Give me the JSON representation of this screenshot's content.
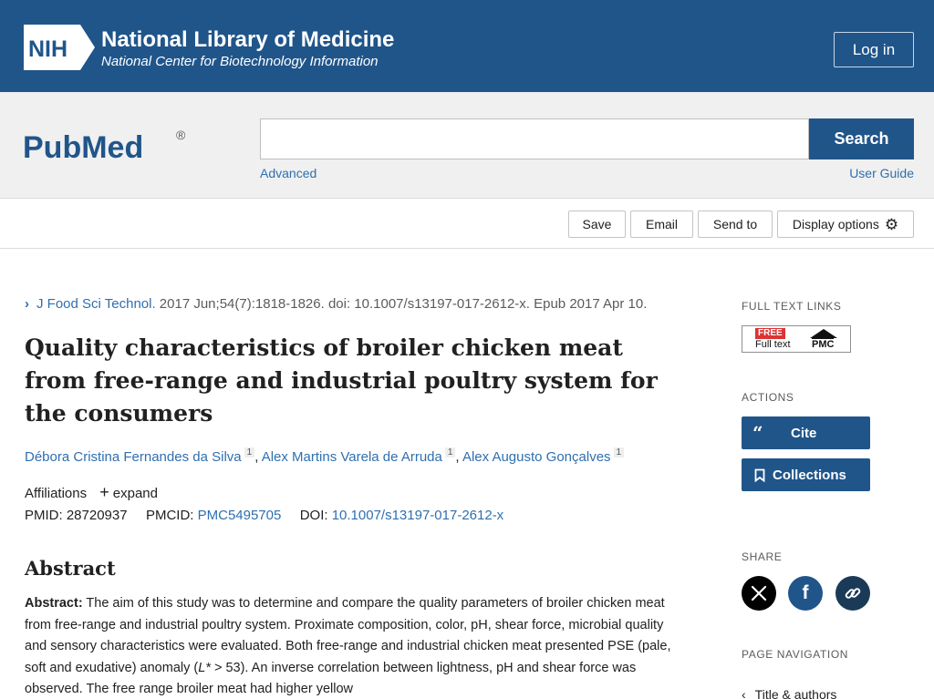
{
  "nih": {
    "logo_text": "NIH",
    "title": "National Library of Medicine",
    "subtitle": "National Center for Biotechnology Information",
    "login_label": "Log in"
  },
  "search": {
    "logo": "PubMed",
    "button_label": "Search",
    "advanced_label": "Advanced",
    "user_guide_label": "User Guide",
    "value": ""
  },
  "toolbar": {
    "save_label": "Save",
    "email_label": "Email",
    "send_to_label": "Send to",
    "display_options_label": "Display options"
  },
  "article": {
    "journal": "J Food Sci Technol.",
    "citation_rest": " 2017 Jun;54(7):1818-1826. doi: 10.1007/s13197-017-2612-x. Epub 2017 Apr 10.",
    "title": "Quality characteristics of broiler chicken meat from free-range and industrial poultry system for the consumers",
    "authors": [
      {
        "name": "Débora Cristina Fernandes da Silva",
        "sup": "1"
      },
      {
        "name": "Alex Martins Varela de Arruda",
        "sup": "1"
      },
      {
        "name": "Alex Augusto Gonçalves",
        "sup": "1"
      }
    ],
    "affiliations_label": "Affiliations",
    "expand_label": "expand",
    "pmid_label": "PMID:",
    "pmid": "28720937",
    "pmcid_label": "PMCID:",
    "pmcid": "PMC5495705",
    "doi_label": "DOI:",
    "doi": "10.1007/s13197-017-2612-x",
    "abstract_heading": "Abstract",
    "abstract_label": "Abstract:",
    "abstract_part1": " The aim of this study was to determine and compare the quality parameters of broiler chicken meat from free-range and industrial poultry system. Proximate composition, color, pH, shear force, microbial quality and sensory characteristics were evaluated. Both free-range and industrial chicken meat presented PSE (pale, soft and exudative) anomaly (",
    "abstract_italic": "L*",
    "abstract_part2": " > 53). An inverse correlation between lightness, pH and shear force was observed. The free range broiler meat had higher yellow"
  },
  "sidebar": {
    "full_text_links": "FULL TEXT LINKS",
    "free_label": "FREE",
    "full_text_label": "Full text",
    "pmc_label": "PMC",
    "actions": "ACTIONS",
    "cite_label": "Cite",
    "collections_label": "Collections",
    "share": "SHARE",
    "page_navigation": "PAGE NAVIGATION",
    "nav_first": "Title & authors"
  },
  "colors": {
    "nih_blue": "#20558a",
    "link_blue": "#2f6fb0",
    "facebook_blue": "#20558a",
    "x_black": "#000000"
  }
}
